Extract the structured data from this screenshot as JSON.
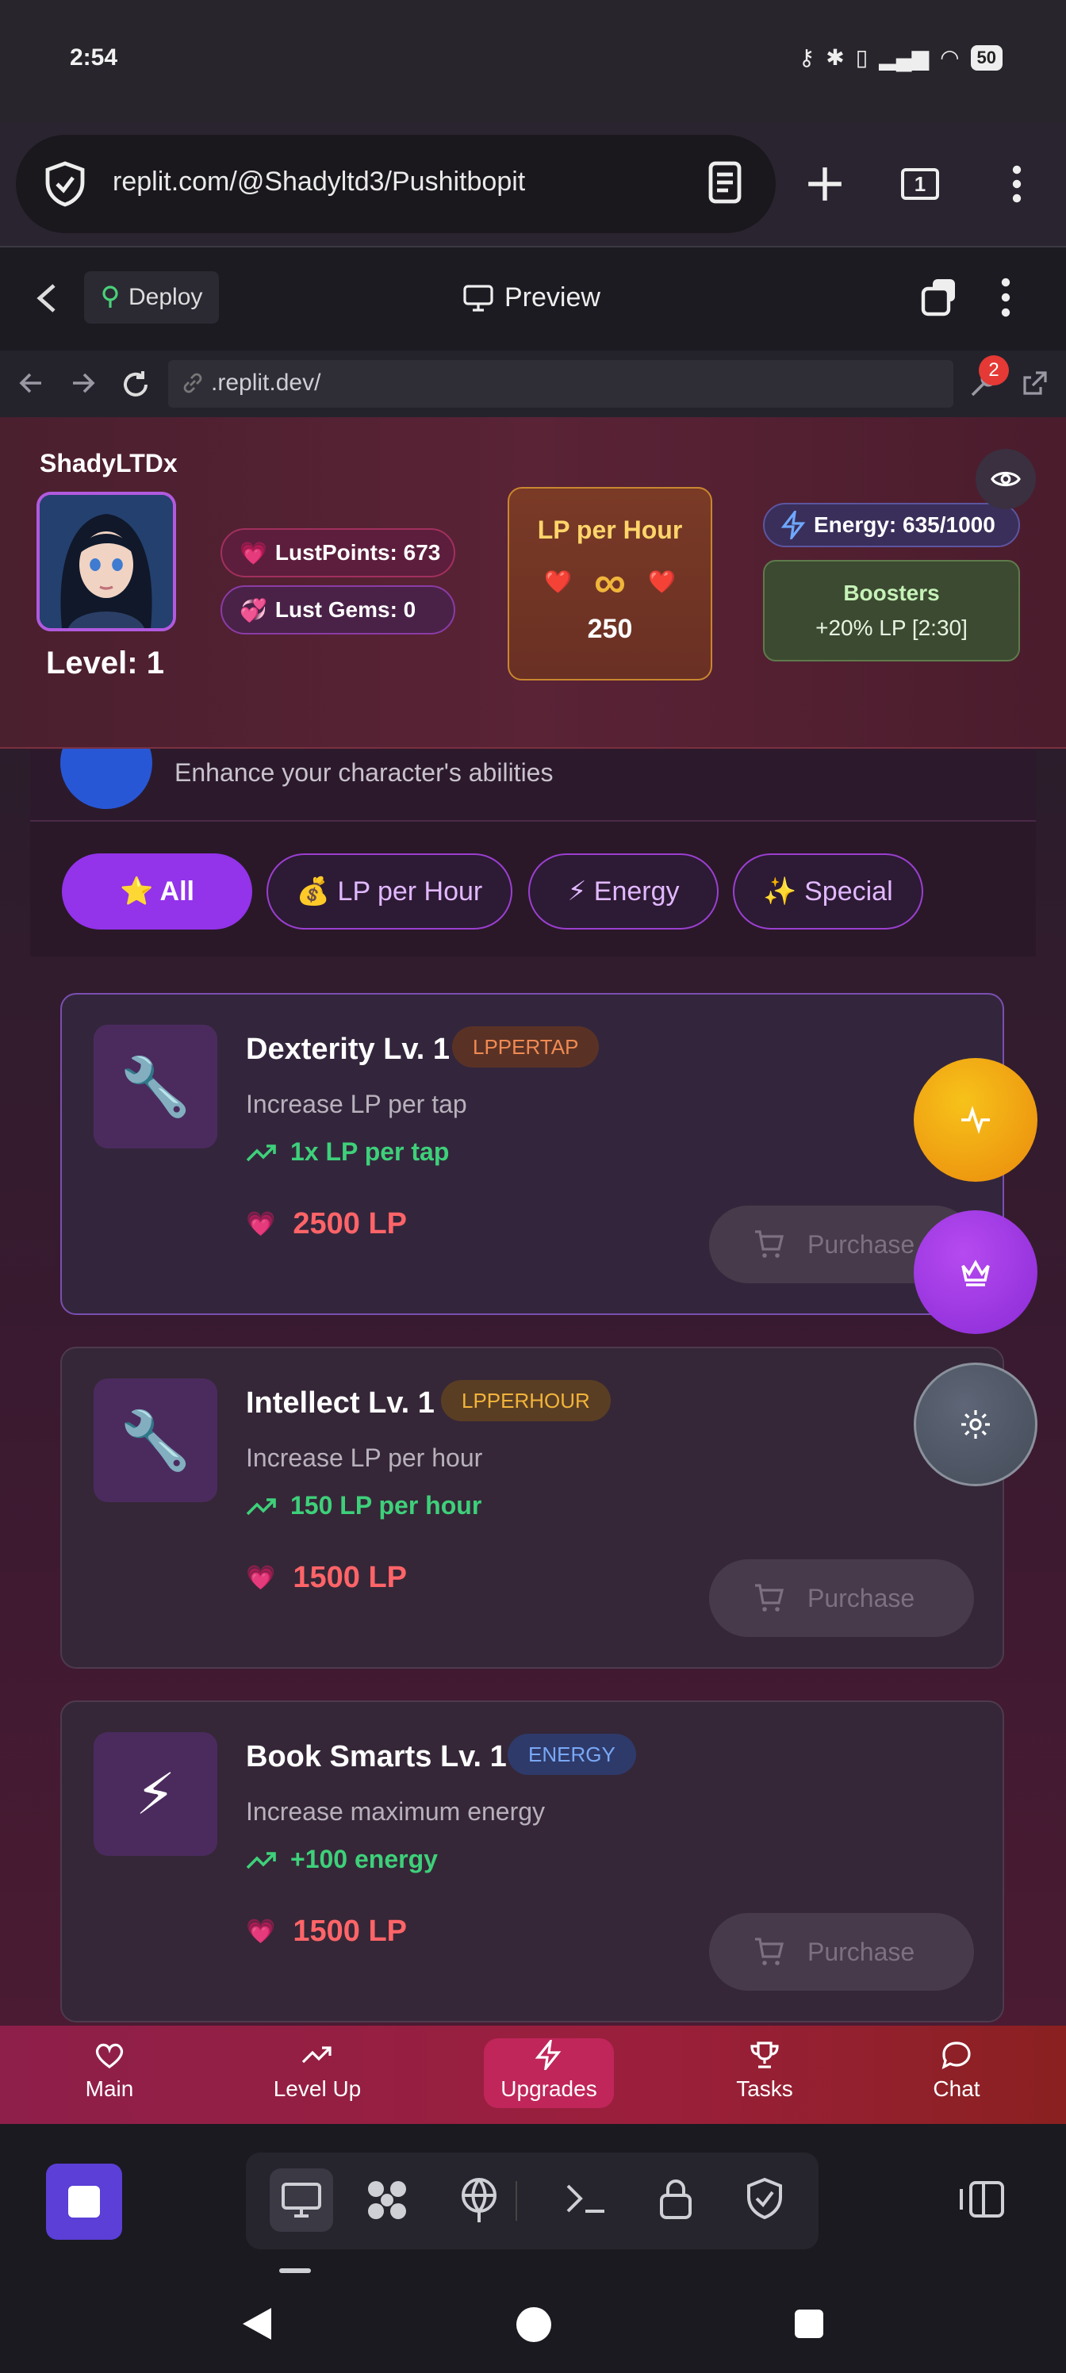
{
  "status_bar": {
    "time": "2:54",
    "battery": "50"
  },
  "browser": {
    "url": "replit.com/@Shadyltd3/Pushitbopit",
    "tab_count": "1"
  },
  "replit": {
    "deploy_label": "Deploy",
    "preview_label": "Preview",
    "inner_url": ".replit.dev/",
    "notification_count": "2"
  },
  "player": {
    "username": "ShadyLTDx",
    "level": "Level: 1",
    "lust_points": "LustPoints: 673",
    "lust_gems": "Lust Gems: 0"
  },
  "lp_per_hour": {
    "title": "LP per Hour",
    "symbol": "∞",
    "value": "250"
  },
  "energy": {
    "label": "Energy: 635/1000"
  },
  "boosters": {
    "title": "Boosters",
    "detail": "+20% LP [2:30]"
  },
  "section": {
    "description": "Enhance your character's abilities"
  },
  "filters": [
    {
      "label": "⭐ All",
      "active": true
    },
    {
      "label": "💰 LP per Hour",
      "active": false
    },
    {
      "label": "⚡ Energy",
      "active": false
    },
    {
      "label": "✨ Special",
      "active": false
    }
  ],
  "upgrades": [
    {
      "icon": "🔧",
      "title": "Dexterity Lv. 1",
      "tag": "LPPERTAP",
      "description": "Increase LP per tap",
      "gain": "1x LP per tap",
      "price": "2500 LP",
      "button": "Purchase"
    },
    {
      "icon": "🔧",
      "title": "Intellect Lv. 1",
      "tag": "LPPERHOUR",
      "description": "Increase LP per hour",
      "gain": "150 LP per hour",
      "price": "1500 LP",
      "button": "Purchase"
    },
    {
      "icon": "⚡",
      "title": "Book Smarts Lv. 1",
      "tag": "ENERGY",
      "description": "Increase maximum energy",
      "gain": "+100 energy",
      "price": "1500 LP",
      "button": "Purchase"
    }
  ],
  "bottom_nav": [
    {
      "label": "Main",
      "active": false
    },
    {
      "label": "Level Up",
      "active": false
    },
    {
      "label": "Upgrades",
      "active": true
    },
    {
      "label": "Tasks",
      "active": false
    },
    {
      "label": "Chat",
      "active": false
    }
  ],
  "colors": {
    "accent_purple": "#9333ea",
    "price_red": "#ff6468",
    "gain_green": "#3ed07a",
    "nav_gradient": "#9b1f3c"
  }
}
